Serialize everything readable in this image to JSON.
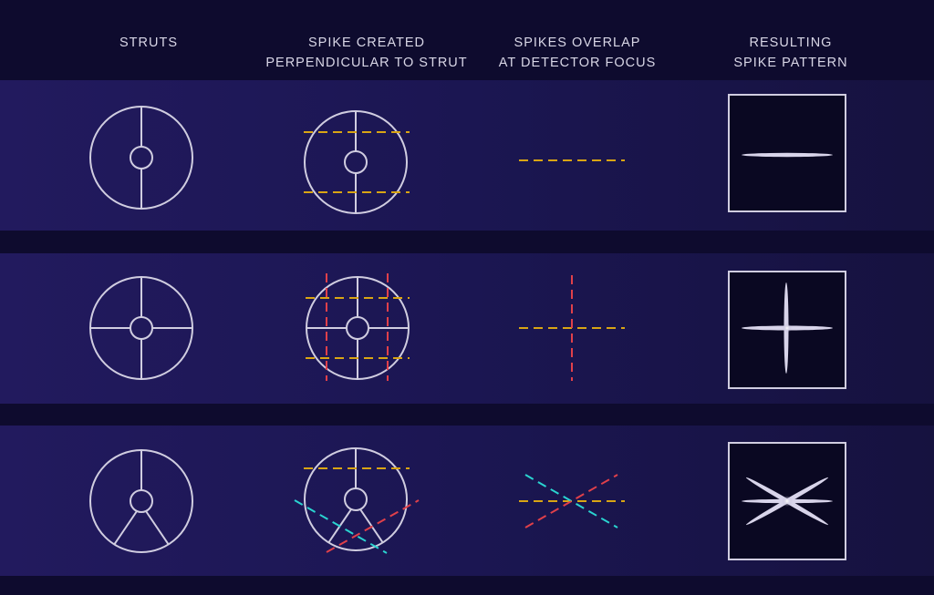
{
  "headers": {
    "col1": [
      "STRUTS"
    ],
    "col2": [
      "SPIKE CREATED",
      "PERPENDICULAR TO STRUT"
    ],
    "col3": [
      "SPIKES OVERLAP",
      "AT DETECTOR FOCUS"
    ],
    "col4": [
      "RESULTING",
      "SPIKE PATTERN"
    ]
  },
  "rows": [
    {
      "struts": 2,
      "spike_colors": [
        "yellow"
      ]
    },
    {
      "struts": 4,
      "spike_colors": [
        "yellow",
        "red"
      ]
    },
    {
      "struts": 3,
      "spike_colors": [
        "yellow",
        "cyan",
        "red"
      ]
    }
  ],
  "colors": {
    "background": "#0e0b2e",
    "band": "#1b1652",
    "outline": "#d0cde0",
    "yellow": "#d9a514",
    "red": "#e0404a",
    "cyan": "#2ad4d0",
    "spike_box": "#0a0822"
  }
}
